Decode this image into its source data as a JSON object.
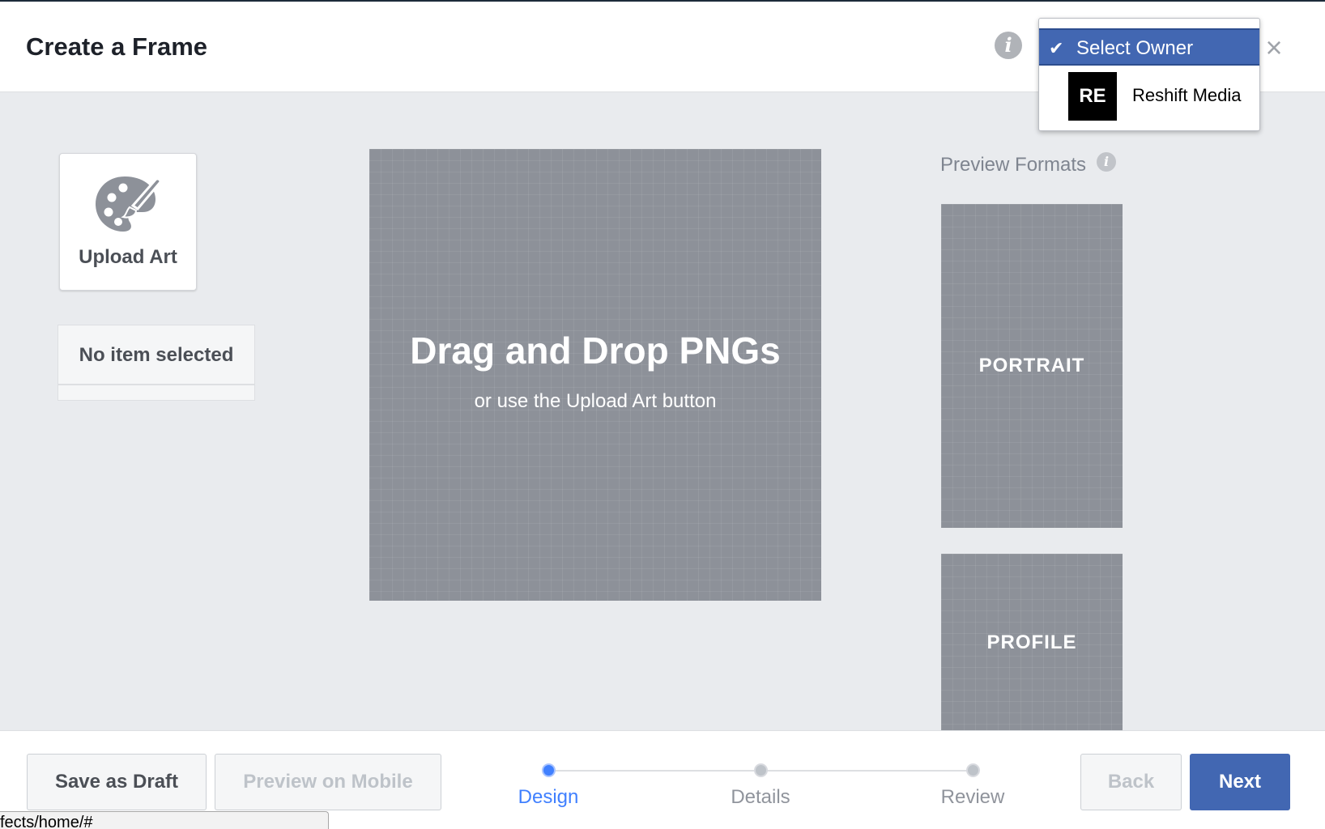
{
  "header": {
    "title": "Create a Frame"
  },
  "owner_dropdown": {
    "selected_label": "Select Owner",
    "options": [
      {
        "logo_text": "RE",
        "name": "Reshift Media"
      }
    ]
  },
  "sidebar": {
    "upload_label": "Upload Art",
    "no_item_label": "No item selected"
  },
  "canvas": {
    "title": "Drag and Drop PNGs",
    "subtitle": "or use the Upload Art button"
  },
  "preview": {
    "title": "Preview Formats",
    "formats": [
      "PORTRAIT",
      "PROFILE"
    ]
  },
  "footer": {
    "save_draft": "Save as Draft",
    "preview_mobile": "Preview on Mobile",
    "steps": [
      {
        "label": "Design",
        "active": true
      },
      {
        "label": "Details",
        "active": false
      },
      {
        "label": "Review",
        "active": false
      }
    ],
    "back": "Back",
    "next": "Next"
  },
  "status_bar": {
    "url": "fects/home/#"
  },
  "colors": {
    "accent": "#4267b2",
    "active_step": "#4080ff",
    "canvas": "#8d9199"
  }
}
